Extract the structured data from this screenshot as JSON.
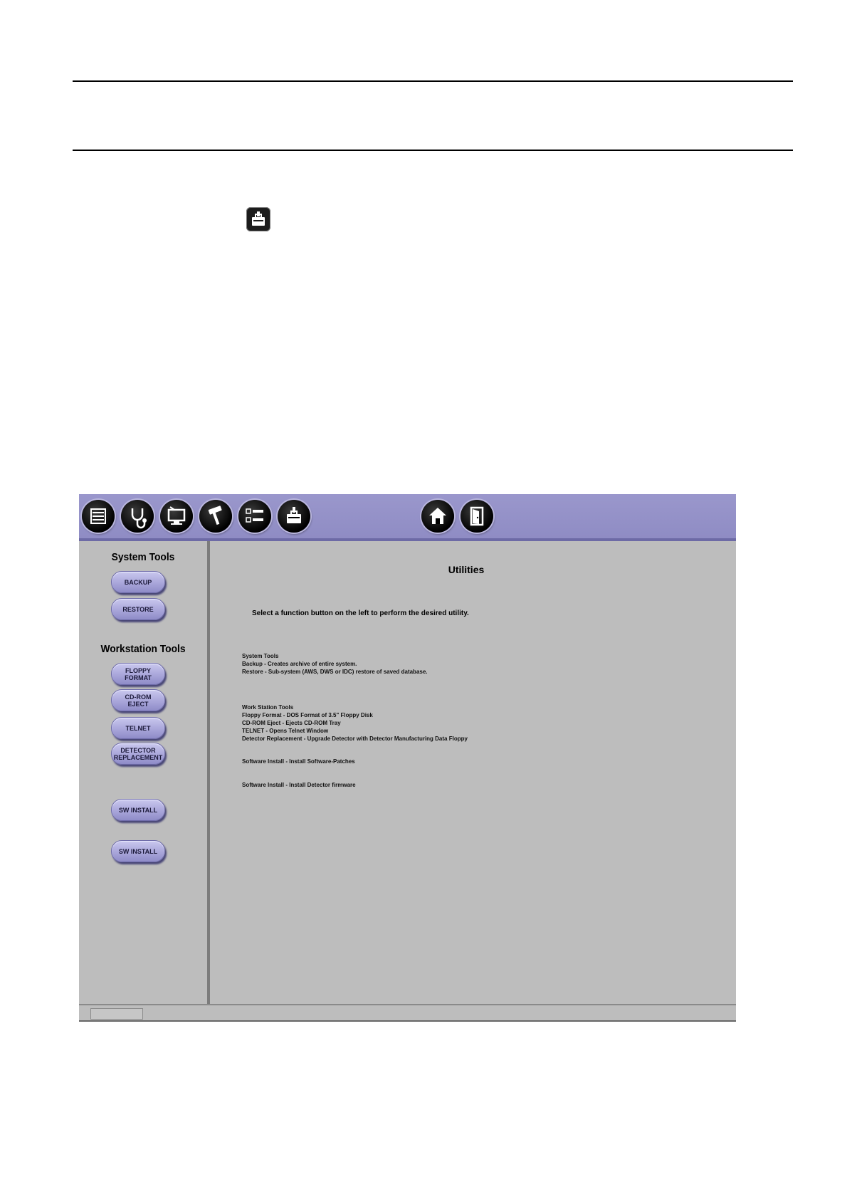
{
  "doc_icon": "toolbox-icon",
  "toolbar": {
    "buttons": [
      {
        "icon": "list-icon"
      },
      {
        "icon": "stethoscope-icon"
      },
      {
        "icon": "monitor-icon"
      },
      {
        "icon": "hammer-icon"
      },
      {
        "icon": "checklist-icon"
      },
      {
        "icon": "toolbox-icon"
      },
      {
        "icon": "home-icon"
      },
      {
        "icon": "exit-door-icon"
      }
    ],
    "color": "#9a97cc"
  },
  "left_panel": {
    "system_tools_title": "System Tools",
    "workstation_tools_title": "Workstation Tools",
    "buttons": {
      "backup": "BACKUP",
      "restore": "RESTORE",
      "floppy_format": "FLOPPY\nFORMAT",
      "cdrom_eject": "CD-ROM\nEJECT",
      "telnet": "TELNET",
      "detector_replacement": "DETECTOR\nREPLACEMENT",
      "sw_install_1": "SW INSTALL",
      "sw_install_2": "SW INSTALL"
    }
  },
  "main": {
    "title": "Utilities",
    "instruction": "Select a function button on the left to perform the desired utility.",
    "system_tools_heading": "System Tools",
    "system_tools_lines": [
      "Backup - Creates archive of entire system.",
      "Restore - Sub-system (AWS, DWS or IDC) restore of saved database."
    ],
    "workstation_tools_heading": "Work Station Tools",
    "workstation_tools_lines": [
      "Floppy Format - DOS Format of 3.5\" Floppy Disk",
      "CD-ROM Eject - Ejects CD-ROM Tray",
      "TELNET - Opens Telnet Window",
      "Detector Replacement - Upgrade Detector with Detector Manufacturing Data Floppy"
    ],
    "sw_install_1": "Software Install - Install Software-Patches",
    "sw_install_2": "Software Install - Install Detector firmware"
  }
}
